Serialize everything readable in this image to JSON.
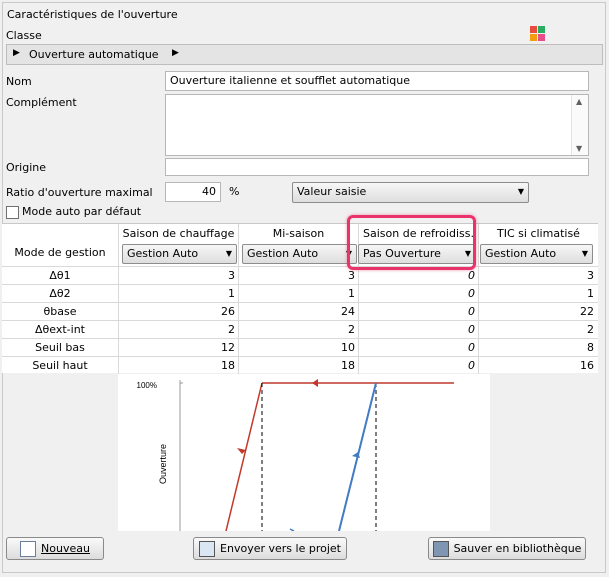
{
  "group": {
    "title": "Caractéristiques de l'ouverture"
  },
  "classe": {
    "label": "Classe",
    "value": "Ouverture automatique",
    "icon": "color-grid-icon"
  },
  "form": {
    "nom_label": "Nom",
    "nom_value": "Ouverture italienne et soufflet automatique",
    "complement_label": "Complément",
    "complement_value": "",
    "origine_label": "Origine",
    "origine_value": "",
    "ratio_label": "Ratio d'ouverture maximal",
    "ratio_value": "40",
    "ratio_unit": "%",
    "ratio_source": "Valeur saisie",
    "mode_auto_label": "Mode auto par défaut",
    "mode_auto_checked": false
  },
  "table": {
    "row_header": "Mode de gestion",
    "columns": [
      {
        "name": "Saison de chauffage",
        "mode": "Gestion Auto"
      },
      {
        "name": "Mi-saison",
        "mode": "Gestion Auto"
      },
      {
        "name": "Saison de refroidiss.",
        "mode": "Pas Ouverture"
      },
      {
        "name": "TIC si climatisé",
        "mode": "Gestion Auto"
      }
    ],
    "rows": [
      {
        "label": "Δθ1",
        "values": [
          "3",
          "3",
          "0",
          "3"
        ]
      },
      {
        "label": "Δθ2",
        "values": [
          "1",
          "1",
          "0",
          "1"
        ]
      },
      {
        "label": "θbase",
        "values": [
          "26",
          "24",
          "0",
          "22"
        ]
      },
      {
        "label": "Δθext-int",
        "values": [
          "2",
          "2",
          "0",
          "2"
        ]
      },
      {
        "label": "Seuil bas",
        "values": [
          "12",
          "10",
          "0",
          "8"
        ]
      },
      {
        "label": "Seuil haut",
        "values": [
          "18",
          "18",
          "0",
          "16"
        ]
      }
    ]
  },
  "chart": {
    "ylabel": "Ouverture",
    "ytick": "100%",
    "colors": {
      "red": "#c0392b",
      "blue": "#3f7cc4"
    }
  },
  "buttons": {
    "new": "Nouveau",
    "send": "Envoyer vers le projet",
    "save": "Sauver en bibliothèque"
  }
}
